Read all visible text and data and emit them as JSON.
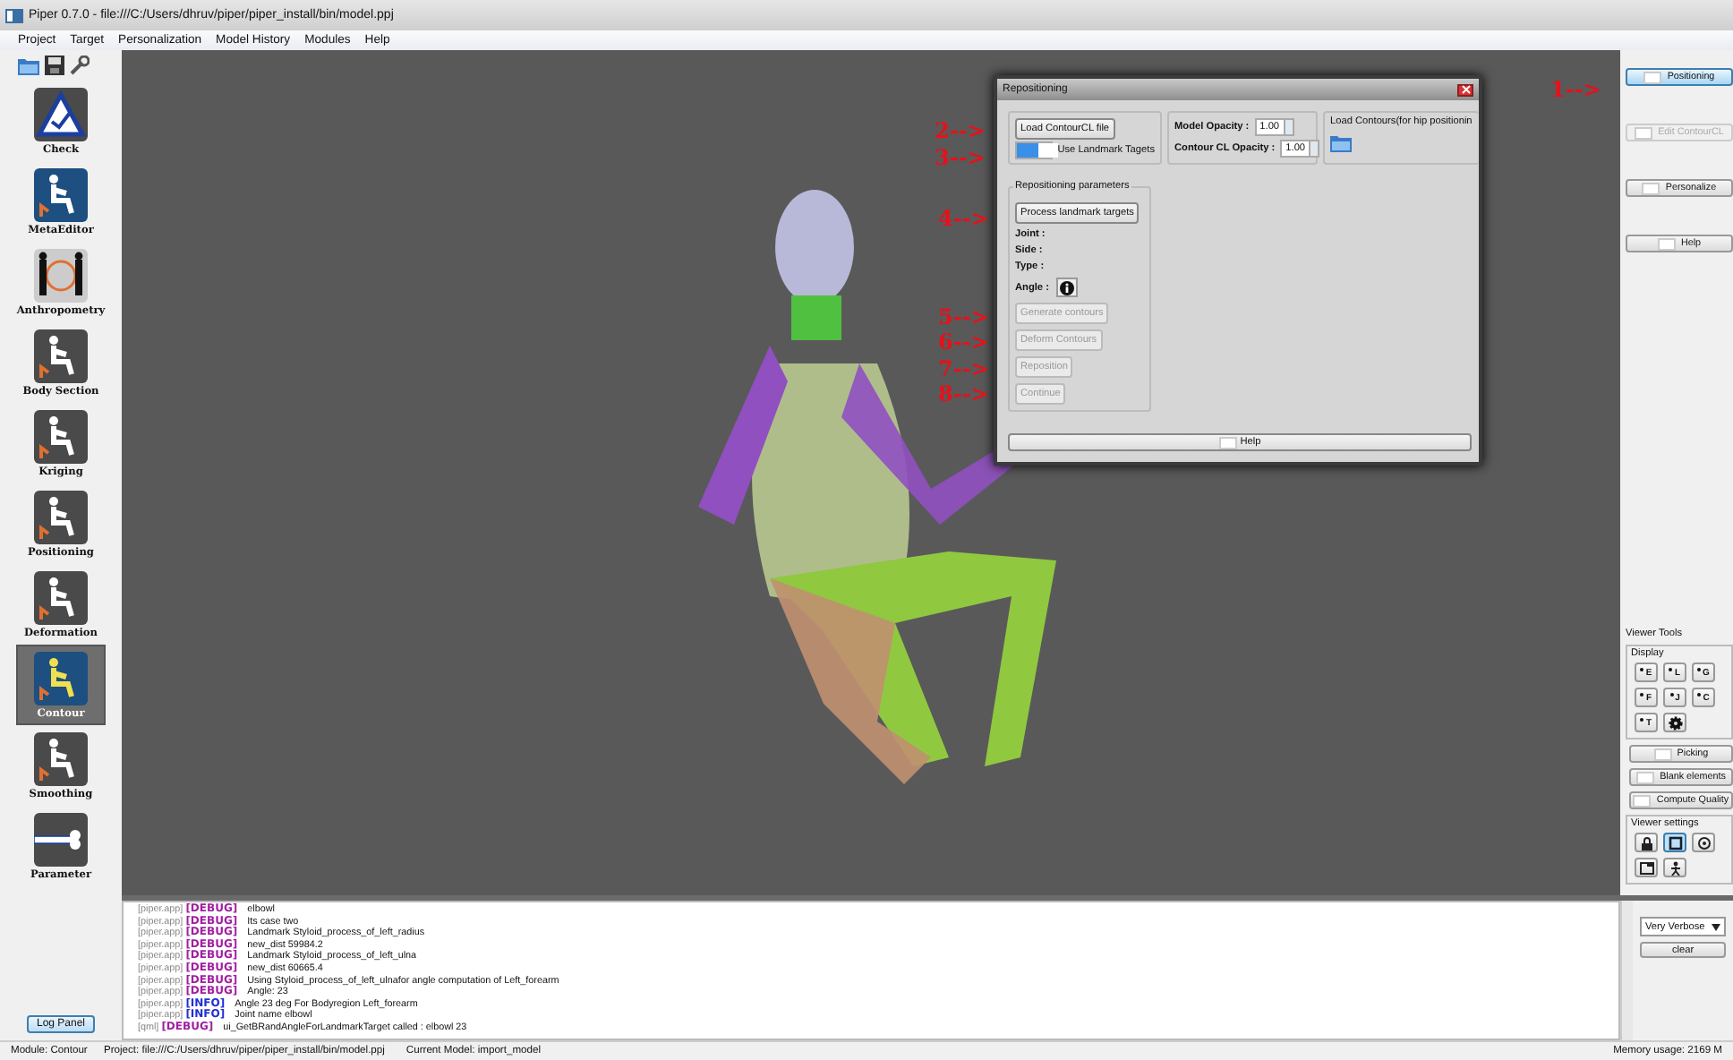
{
  "window": {
    "title": "Piper 0.7.0 - file:///C:/Users/dhruv/piper/piper_install/bin/model.ppj"
  },
  "menu": [
    "Project",
    "Target",
    "Personalization",
    "Model History",
    "Modules",
    "Help"
  ],
  "modules": [
    {
      "label": "Check",
      "selected": false
    },
    {
      "label": "MetaEditor",
      "selected": false
    },
    {
      "label": "Anthropometry",
      "selected": false
    },
    {
      "label": "Body Section",
      "selected": false
    },
    {
      "label": "Kriging",
      "selected": false
    },
    {
      "label": "Positioning",
      "selected": false
    },
    {
      "label": "Deformation",
      "selected": false
    },
    {
      "label": "Contour",
      "selected": true
    },
    {
      "label": "Smoothing",
      "selected": false
    },
    {
      "label": "Parameter",
      "selected": false
    }
  ],
  "log_panel_button": "Log Panel",
  "dialog": {
    "title": "Repositioning",
    "load_button": "Load ContourCL file",
    "toggle": {
      "label": "Use Landmark Tagets",
      "on": true
    },
    "opacities": [
      {
        "label": "Model Opacity :",
        "value": "1.00"
      },
      {
        "label": "Contour CL Opacity :",
        "value": "1.00"
      }
    ],
    "load_contours": "Load Contours(for hip positionin",
    "params_title": "Repositioning parameters",
    "process_button": "Process landmark targets",
    "fields": [
      "Joint :",
      "Side :",
      "Type :",
      "Angle :"
    ],
    "buttons": [
      {
        "label": "Generate contours",
        "disabled": true
      },
      {
        "label": "Deform Contours",
        "disabled": true
      },
      {
        "label": "Reposition",
        "disabled": true
      },
      {
        "label": "Continue",
        "disabled": true
      }
    ],
    "help": "Help"
  },
  "annotations": [
    "1-->",
    "2-->",
    "3-->",
    "4-->",
    "5-->",
    "6-->",
    "7-->",
    "8-->"
  ],
  "right_panel": {
    "buttons": [
      {
        "label": "Positioning",
        "selected": true,
        "disabled": false
      },
      {
        "label": "Edit ContourCL",
        "selected": false,
        "disabled": true
      },
      {
        "label": "Personalize",
        "selected": false,
        "disabled": false
      },
      {
        "label": "Help",
        "selected": false,
        "disabled": false
      }
    ],
    "viewer_tools": "Viewer Tools",
    "display": "Display",
    "display_keys": [
      "E",
      "L",
      "G",
      "F",
      "J",
      "C",
      "T"
    ],
    "tool_buttons": [
      "Picking",
      "Blank elements",
      "Compute Quality"
    ],
    "viewer_settings": "Viewer settings"
  },
  "log": {
    "lines": [
      {
        "source": "[piper.app]",
        "level": "[DEBUG]",
        "color": "#a020a0",
        "message": "elbowl"
      },
      {
        "source": "[piper.app]",
        "level": "[DEBUG]",
        "color": "#a020a0",
        "message": "Its case two"
      },
      {
        "source": "[piper.app]",
        "level": "[DEBUG]",
        "color": "#a020a0",
        "message": "Landmark Styloid_process_of_left_radius"
      },
      {
        "source": "[piper.app]",
        "level": "[DEBUG]",
        "color": "#a020a0",
        "message": "new_dist 59984.2"
      },
      {
        "source": "[piper.app]",
        "level": "[DEBUG]",
        "color": "#a020a0",
        "message": "Landmark Styloid_process_of_left_ulna"
      },
      {
        "source": "[piper.app]",
        "level": "[DEBUG]",
        "color": "#a020a0",
        "message": "new_dist 60665.4"
      },
      {
        "source": "[piper.app]",
        "level": "[DEBUG]",
        "color": "#a020a0",
        "message": "Using Styloid_process_of_left_ulnafor angle computation of Left_forearm"
      },
      {
        "source": "[piper.app]",
        "level": "[DEBUG]",
        "color": "#a020a0",
        "message": "Angle: 23"
      },
      {
        "source": "[piper.app]",
        "level": "[INFO]",
        "color": "#2030d0",
        "message": "Angle 23 deg For Bodyregion Left_forearm"
      },
      {
        "source": "[piper.app]",
        "level": "[INFO]",
        "color": "#2030d0",
        "message": "Joint name elbowl"
      },
      {
        "source": "[qml]",
        "level": "[DEBUG]",
        "color": "#a020a0",
        "message": "ui_GetBRandAngleForLandmarkTarget called : elbowl 23"
      }
    ],
    "verbosity": "Very Verbose",
    "clear": "clear"
  },
  "status_bar": {
    "module": "Module: Contour",
    "project": "Project: file:///C:/Users/dhruv/piper/piper_install/bin/model.ppj",
    "model": "Current Model: import_model",
    "memory": "Memory usage: 2169 M"
  }
}
